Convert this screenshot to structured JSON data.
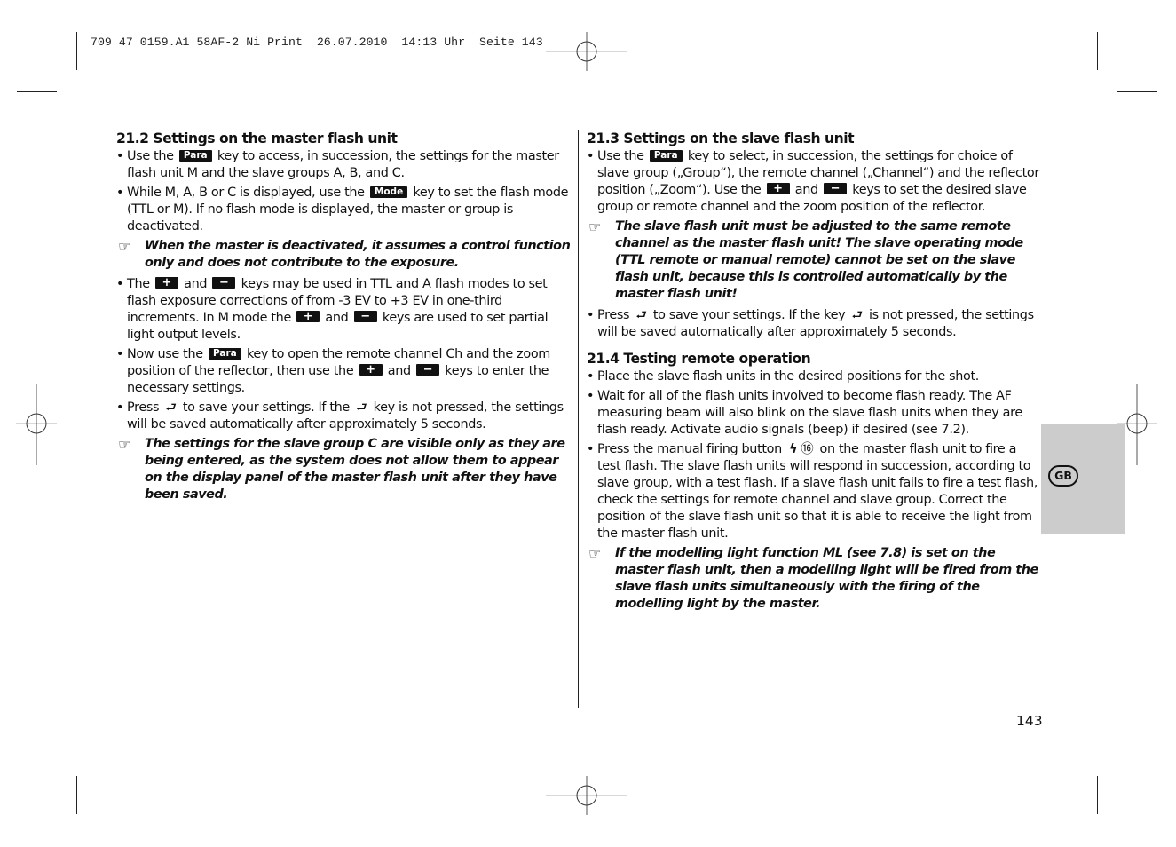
{
  "print_slug": "709 47 0159.A1 58AF-2 Ni Print  26.07.2010  14:13 Uhr  Seite 143",
  "keys": {
    "para": "Para",
    "mode": "Mode",
    "plus": "+",
    "minus": "−",
    "enter": "⮐",
    "bolt": "ϟ",
    "item16": "⑯"
  },
  "left": {
    "heading": "21.2 Settings on the master flash unit",
    "b1": {
      "pre": "Use the ",
      "post": " key to access, in succession, the settings for the master flash unit M and the slave groups A, B, and C."
    },
    "b2": {
      "pre": "While M, A, B or C is displayed, use the ",
      "post": " key to set the flash mode (TTL or M). If no flash mode is displayed, the master or group is deactivated."
    },
    "n1": "When the master is deactivated, it assumes a control function only and does not contribute to the exposure.",
    "b3": {
      "pre": "The ",
      "mid1": " and ",
      "mid2": "  keys may be used in TTL and A flash modes to set flash exposure corrections of from -3 EV to +3 EV in one-third increments. In M mode the ",
      "mid3": " and ",
      "post": "  keys are used to set partial light output levels."
    },
    "b4": {
      "pre": "Now use the ",
      "mid1": " key to open the remote channel Ch and the zoom position of the reflector, then use the ",
      "mid2": " and ",
      "post": "  keys to enter the necessary settings."
    },
    "b5": {
      "pre": "Press ",
      "mid": "  to save your settings. If the ",
      "post": " key is not pressed, the settings will be saved automatically after approximately 5 seconds."
    },
    "n2": "The settings for the slave group C are visible only as they are being entered, as the system does not allow them to appear on the display panel of the master flash unit after they have been saved."
  },
  "right": {
    "heading1": "21.3 Settings on the slave flash unit",
    "b1": {
      "pre": "Use the ",
      "mid1": " key to select, in succession, the settings for choice of slave group („Group“), the remote channel („Channel“) and the reflector position („Zoom“). Use the ",
      "mid2": " and ",
      "post": "  keys to set the desired slave group or remote channel and the zoom position of the reflector."
    },
    "n1": "The slave flash unit must be adjusted to the same remote channel as the master flash unit! The slave operating mode (TTL remote or manual remote) cannot be set on the slave flash unit, because this is controlled automatically by the master flash unit!",
    "b2": {
      "pre": "Press ",
      "mid": " to save your settings. If the key ",
      "post": " is not pressed, the settings will be saved automatically after approximately 5 seconds."
    },
    "heading2": "21.4 Testing remote operation",
    "b3": "Place the slave flash units in the desired positions for the shot.",
    "b4": "Wait for all of the flash units involved to become flash ready. The AF measuring beam will also blink on the slave flash units when they are flash ready. Activate audio signals (beep) if desired (see 7.2).",
    "b5": {
      "pre": "Press the manual firing button ",
      "post": " on the master flash unit to fire a test flash. The slave flash units will respond in succession, according to slave group, with a test flash. If a slave flash unit fails to fire a test flash, check the settings for remote channel and slave group. Correct the position of the slave flash unit so that it is able to receive the light from the master flash unit."
    },
    "n2": "If the modelling light function ML (see 7.8) is set on the master flash unit, then a modelling light will be fired from the slave flash units simultaneously with the firing of the modelling light by the master."
  },
  "language_tab": "GB",
  "page_number": "143",
  "bullet_char": "•",
  "note_char": "☞"
}
